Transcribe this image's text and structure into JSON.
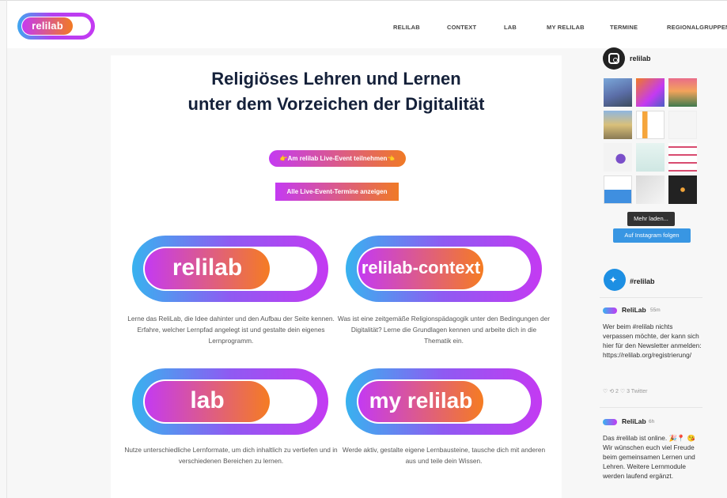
{
  "header": {
    "logo_text": "relilab",
    "nav": [
      "RELILAB",
      "CONTEXT",
      "LAB",
      "MY RELILAB",
      "TERMINE",
      "REGIONALGRUPPEN"
    ]
  },
  "main": {
    "title_line1": "Religiöses Lehren und Lernen",
    "title_line2": "unter dem Vorzeichen der Digitalität",
    "btn_live": "👉Am relilab Live-Event teilnehmen👈",
    "btn_all": "Alle Live-Event-Termine anzeigen",
    "cards": [
      {
        "label": "relilab",
        "desc": "Lerne das ReliLab, die Idee dahinter und den Aufbau der Seite kennen. Erfahre, welcher Lernpfad angelegt ist und gestalte dein eigenes Lernprogramm."
      },
      {
        "label": "relilab-context",
        "desc": "Was ist eine zeitgemäße Religionspädagogik unter den Bedingungen der Digitalität? Lerne die Grundlagen kennen und arbeite dich in die Thematik ein."
      },
      {
        "label": "lab",
        "desc": "Nutze unterschiedliche Lernformate, um dich inhaltlich zu vertiefen und in verschiedenen Bereichen zu lernen."
      },
      {
        "label": "my relilab",
        "desc": "Werde aktiv, gestalte eigene Lernbausteine, tausche dich mit anderen aus und teile dein Wissen."
      }
    ]
  },
  "sidebar": {
    "instagram_name": "relilab",
    "load_more": "Mehr laden...",
    "follow": "Auf Instagram folgen",
    "twitter_hashtag": "#relilab",
    "tweets": [
      {
        "author": "ReliLab",
        "time": "55m",
        "text": "Wer beim #relilab nichts verpassen möchte, der kann sich hier für den Newsletter anmelden: https://relilab.org/registrierung/",
        "actions": "♡   ⟲ 2   ♡ 3   Twitter"
      },
      {
        "author": "ReliLab",
        "time": "6h",
        "text": "Das #relilab ist online. 🎉📍 😘 Wir wünschen euch viel Freude beim gemeinsamen Lernen und Lehren. Weitere Lernmodule werden laufend ergänzt."
      }
    ]
  },
  "colors": {
    "purple": "#c43af2",
    "orange": "#f57c22",
    "blue": "#38b2ef",
    "twitter": "#1d8fe3",
    "instagram_button": "#3896e3"
  },
  "icons": [
    "instagram-icon",
    "twitter-icon",
    "heart-icon",
    "retweet-icon"
  ]
}
